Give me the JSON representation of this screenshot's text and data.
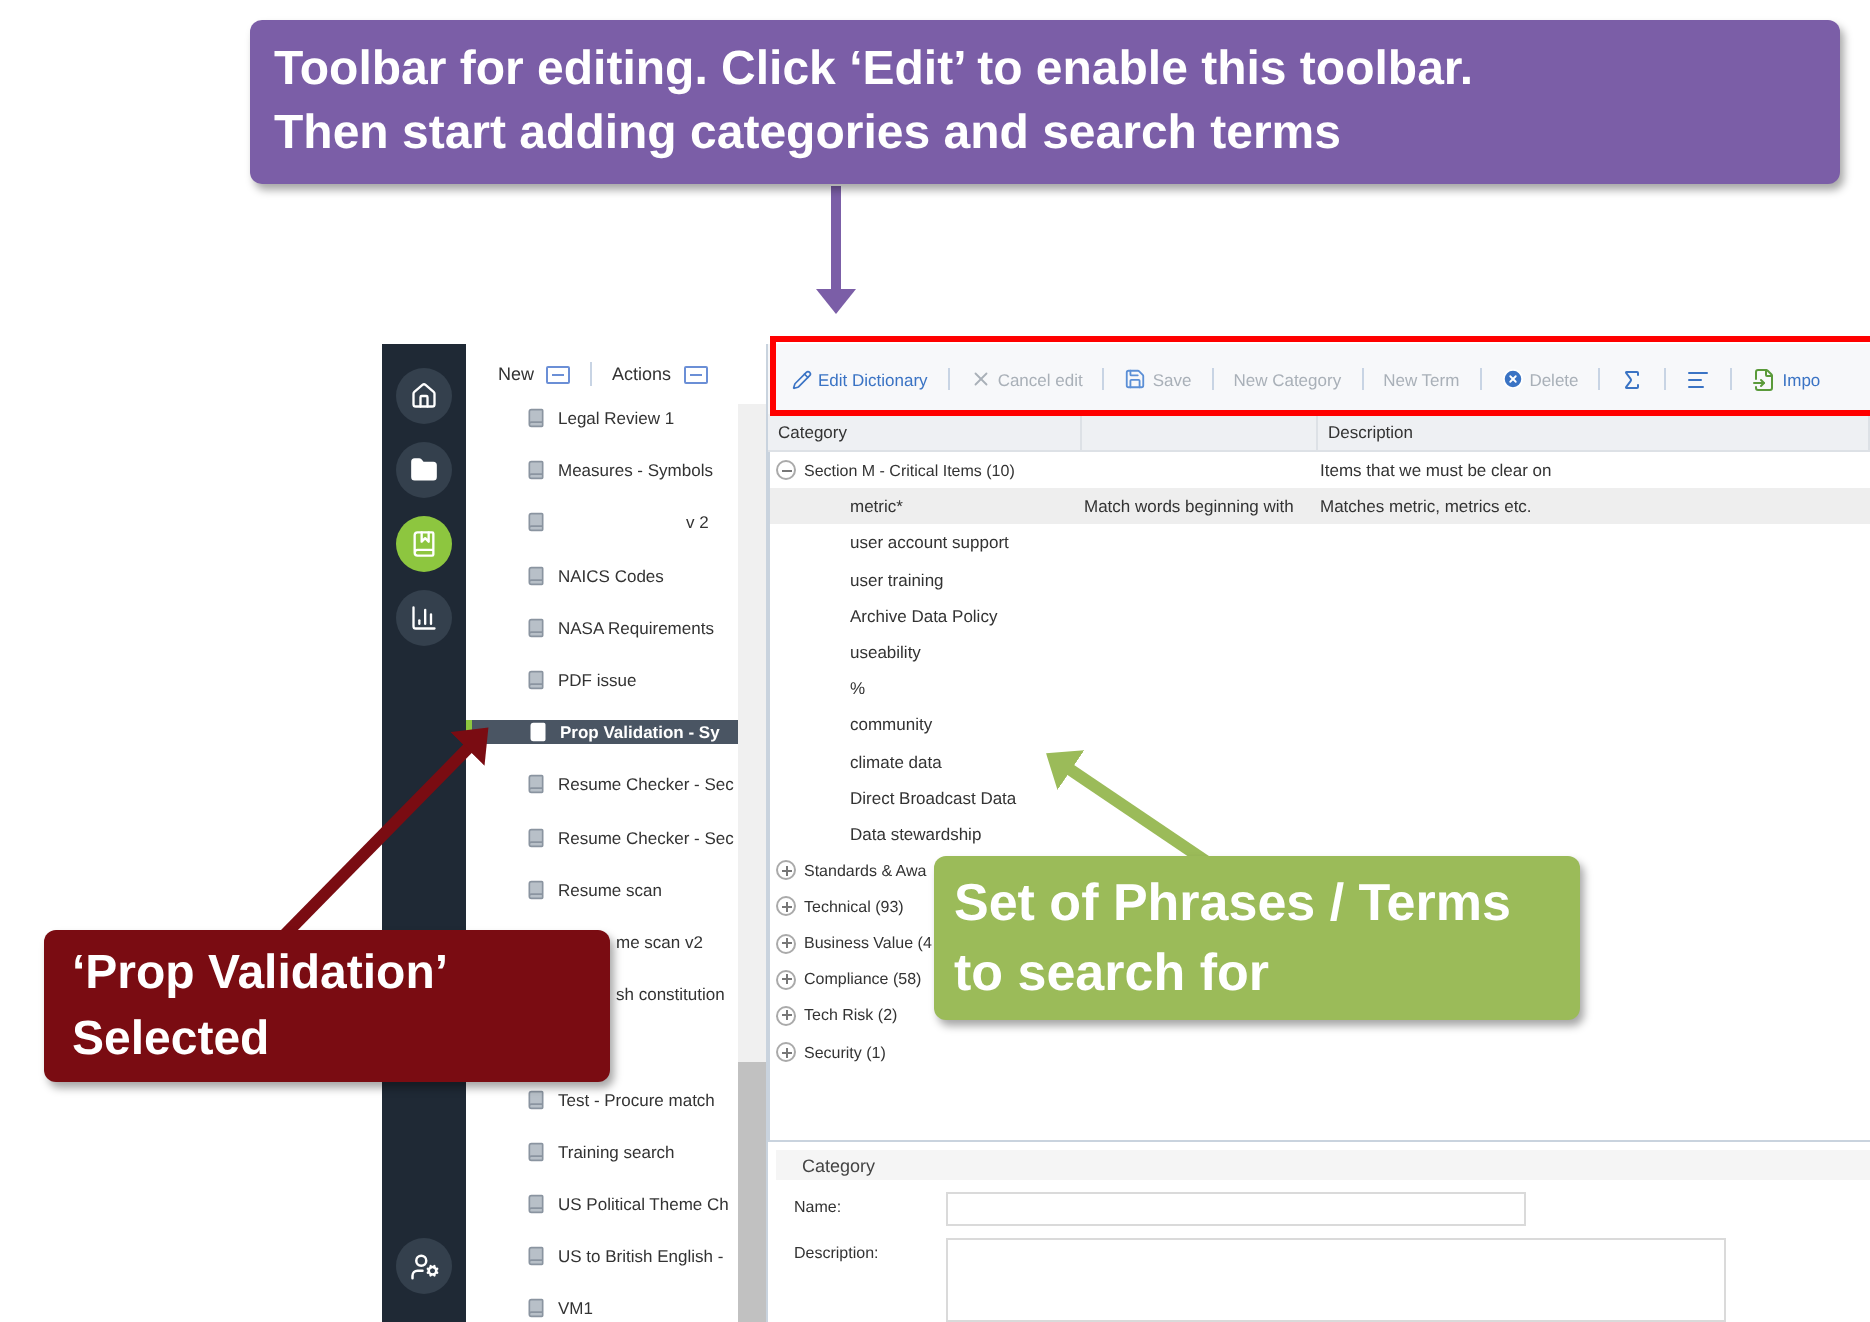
{
  "annotations": [
    {
      "kind": "top",
      "color": "#7b5ea7",
      "lines": [
        "Toolbar for editing. Click ‘Edit’ to enable this toolbar.",
        "Then start adding categories and search terms"
      ]
    },
    {
      "kind": "left",
      "color": "#7a0c12",
      "lines": [
        "‘Prop Validation’",
        "Selected"
      ]
    },
    {
      "kind": "middle",
      "color": "#9bbb59",
      "lines": [
        "Set of Phrases / Terms",
        "to search for"
      ]
    }
  ],
  "nav_rail": [
    {
      "kind": "home",
      "selected": false
    },
    {
      "kind": "folder",
      "selected": false
    },
    {
      "kind": "book",
      "selected": true
    },
    {
      "kind": "chart",
      "selected": false
    },
    {
      "kind": "user",
      "selected": false
    }
  ],
  "list_panel": {
    "new_label": "New",
    "actions_label": "Actions",
    "items": [
      {
        "label": "Legal Review 1",
        "selected": false
      },
      {
        "label": "Measures - Symbols",
        "selected": false
      },
      {
        "label": "v 2",
        "selected": false,
        "kind": "redacted"
      },
      {
        "label": "NAICS Codes",
        "selected": false
      },
      {
        "label": "NASA Requirements",
        "selected": false
      },
      {
        "label": "PDF issue",
        "selected": false
      },
      {
        "label": "Prop Validation - Sy",
        "selected": true
      },
      {
        "label": "Resume Checker - Sec",
        "selected": false
      },
      {
        "label": "Resume Checker - Sec",
        "selected": false
      },
      {
        "label": "Resume scan",
        "selected": false
      },
      {
        "label": "me scan v2",
        "selected": false,
        "kind": "cut"
      },
      {
        "label": "sh constitution",
        "selected": false,
        "kind": "cut"
      },
      {
        "selected": false,
        "kind": "covered"
      },
      {
        "label": "Test - Procure match",
        "selected": false
      },
      {
        "label": "Training search",
        "selected": false
      },
      {
        "label": "US Political Theme Ch",
        "selected": false
      },
      {
        "label": "US to British English -",
        "selected": false
      },
      {
        "label": "VM1",
        "selected": false
      }
    ]
  },
  "toolbar": [
    {
      "kind": "edit",
      "label": "Edit Dictionary",
      "disabled": false
    },
    {
      "kind": "cancel",
      "label": "Cancel edit",
      "disabled": true
    },
    {
      "kind": "save",
      "label": "Save",
      "disabled": true
    },
    {
      "kind": "text",
      "label": "New Category",
      "disabled": true
    },
    {
      "kind": "text",
      "label": "New Term",
      "disabled": true
    },
    {
      "kind": "delete",
      "label": "Delete",
      "disabled": true
    },
    {
      "kind": "sigma",
      "disabled": false
    },
    {
      "kind": "align",
      "disabled": false
    },
    {
      "kind": "import",
      "label": "Impo",
      "disabled": false
    }
  ],
  "table": {
    "columns": [
      "Category",
      "Description"
    ],
    "rows": [
      {
        "label": "Section M - Critical Items (10)",
        "description": "Items that we must be clear on",
        "expanded": true,
        "children": [
          {
            "label": "metric*",
            "match": "Match words beginning with",
            "description": "Matches metric, metrics etc.",
            "selected": true
          },
          {
            "label": "user account support",
            "selected": false
          },
          {
            "label": "user training",
            "selected": false
          },
          {
            "label": "Archive Data Policy",
            "selected": false
          },
          {
            "label": "useability",
            "selected": false
          },
          {
            "label": "%",
            "selected": false
          },
          {
            "label": "community",
            "selected": false
          },
          {
            "label": "climate data",
            "selected": false
          },
          {
            "label": "Direct Broadcast Data",
            "selected": false
          },
          {
            "label": "Data stewardship",
            "selected": false
          }
        ]
      },
      {
        "label": "Standards & Awa",
        "expanded": false
      },
      {
        "label": "Technical (93)",
        "expanded": false
      },
      {
        "label": "Business Value (4",
        "expanded": false
      },
      {
        "label": "Compliance (58)",
        "expanded": false
      },
      {
        "label": "Tech Risk (2)",
        "expanded": false
      },
      {
        "label": "Security (1)",
        "expanded": false
      }
    ]
  },
  "form": {
    "title": "Category",
    "fields": [
      {
        "label": "Name:",
        "kind": "input"
      },
      {
        "label": "Description:",
        "kind": "textarea"
      }
    ]
  }
}
